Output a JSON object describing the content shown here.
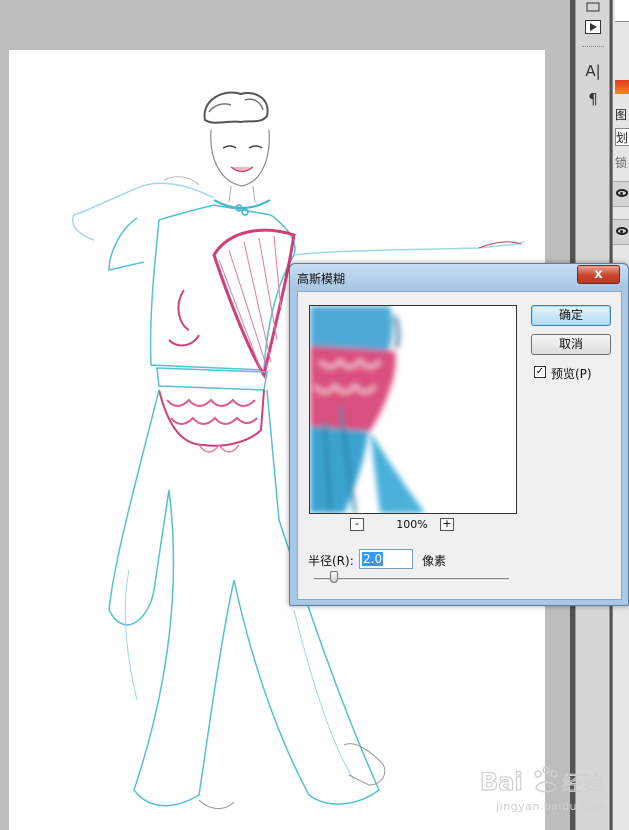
{
  "app": {
    "tool_strip": {
      "icons": [
        "play-icon",
        "type-icon",
        "paragraph-icon"
      ],
      "type_glyph": "A|",
      "paragraph_glyph": "¶"
    },
    "layers_panel": {
      "tab_glyph": "图",
      "mode_glyph": "划",
      "lock_glyph": "锁"
    }
  },
  "dialog": {
    "title": "高斯模糊",
    "close_label": "x",
    "ok_label": "确定",
    "cancel_label": "取消",
    "preview_checked": true,
    "preview_label": "预览(P)",
    "zoom_out_label": "-",
    "zoom_in_label": "+",
    "zoom_level": "100%",
    "radius_label": "半径(R):",
    "radius_value": "2.0",
    "radius_unit": "像素",
    "radius_slider_fraction": 0.1
  },
  "watermark": {
    "text": "jingyan.baidu.com"
  },
  "colors": {
    "canvas_bg": "#bdbdbd",
    "dock_bg": "#535353",
    "dialog_frame": "#a9c8e6",
    "ok_accent": "#3c7fb1",
    "close_red": "#c9452c"
  }
}
